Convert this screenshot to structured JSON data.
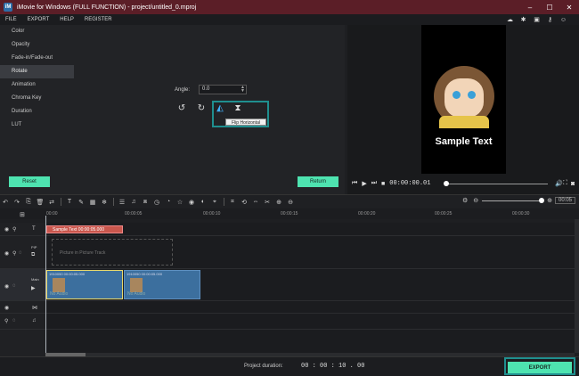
{
  "window": {
    "title": "iMovie for Windows (FULL FUNCTION) - project/untitled_0.mproj",
    "logo": "iM",
    "minimize": "–",
    "maximize": "☐",
    "close": "✕"
  },
  "menu": {
    "items": [
      "FILE",
      "EXPORT",
      "HELP",
      "REGISTER"
    ],
    "right_icons": [
      "cloud-icon",
      "bug-icon",
      "store-icon",
      "key-icon",
      "user-icon"
    ]
  },
  "sidebar": {
    "items": [
      {
        "label": "Color",
        "active": false
      },
      {
        "label": "Opacity",
        "active": false
      },
      {
        "label": "Fade-in/Fade-out",
        "active": false
      },
      {
        "label": "Rotate",
        "active": true
      },
      {
        "label": "Animation",
        "active": false
      },
      {
        "label": "Chroma Key",
        "active": false
      },
      {
        "label": "Duration",
        "active": false
      },
      {
        "label": "LUT",
        "active": false
      }
    ]
  },
  "rotate": {
    "angle_label": "Angle:",
    "angle_value": "0.0",
    "tooltip": "Flip Horizontal"
  },
  "buttons": {
    "reset": "Reset",
    "return": "Return",
    "export": "EXPORT"
  },
  "preview": {
    "sample_text": "Sample Text",
    "timecode": "00:00:00.01"
  },
  "timeline": {
    "ruler": [
      "00:00",
      "00:00:05",
      "00:00:10",
      "00:00:15",
      "00:00:20",
      "00:00:25",
      "00:00:30"
    ],
    "text_clip": "Sample Text   00:00:05.000",
    "pip_placeholder": "Picture in Picture Track",
    "pip_label": "PIP",
    "main_label": "Main",
    "clips": [
      {
        "label": "1910050   00:00:05.000",
        "audio": "No Audio"
      },
      {
        "label": "1910050   00:00:05.000",
        "audio": "No Audio"
      }
    ],
    "zoom_value": "00:05"
  },
  "footer": {
    "duration_label": "Project duration:",
    "duration_value": "00 : 00 : 10 . 00"
  },
  "colors": {
    "accent": "#4ee3b0",
    "title_bar": "#5b1e27",
    "highlight": "#1f8f8f",
    "text_clip": "#c9574d",
    "main_clip": "#3c6f9e"
  }
}
